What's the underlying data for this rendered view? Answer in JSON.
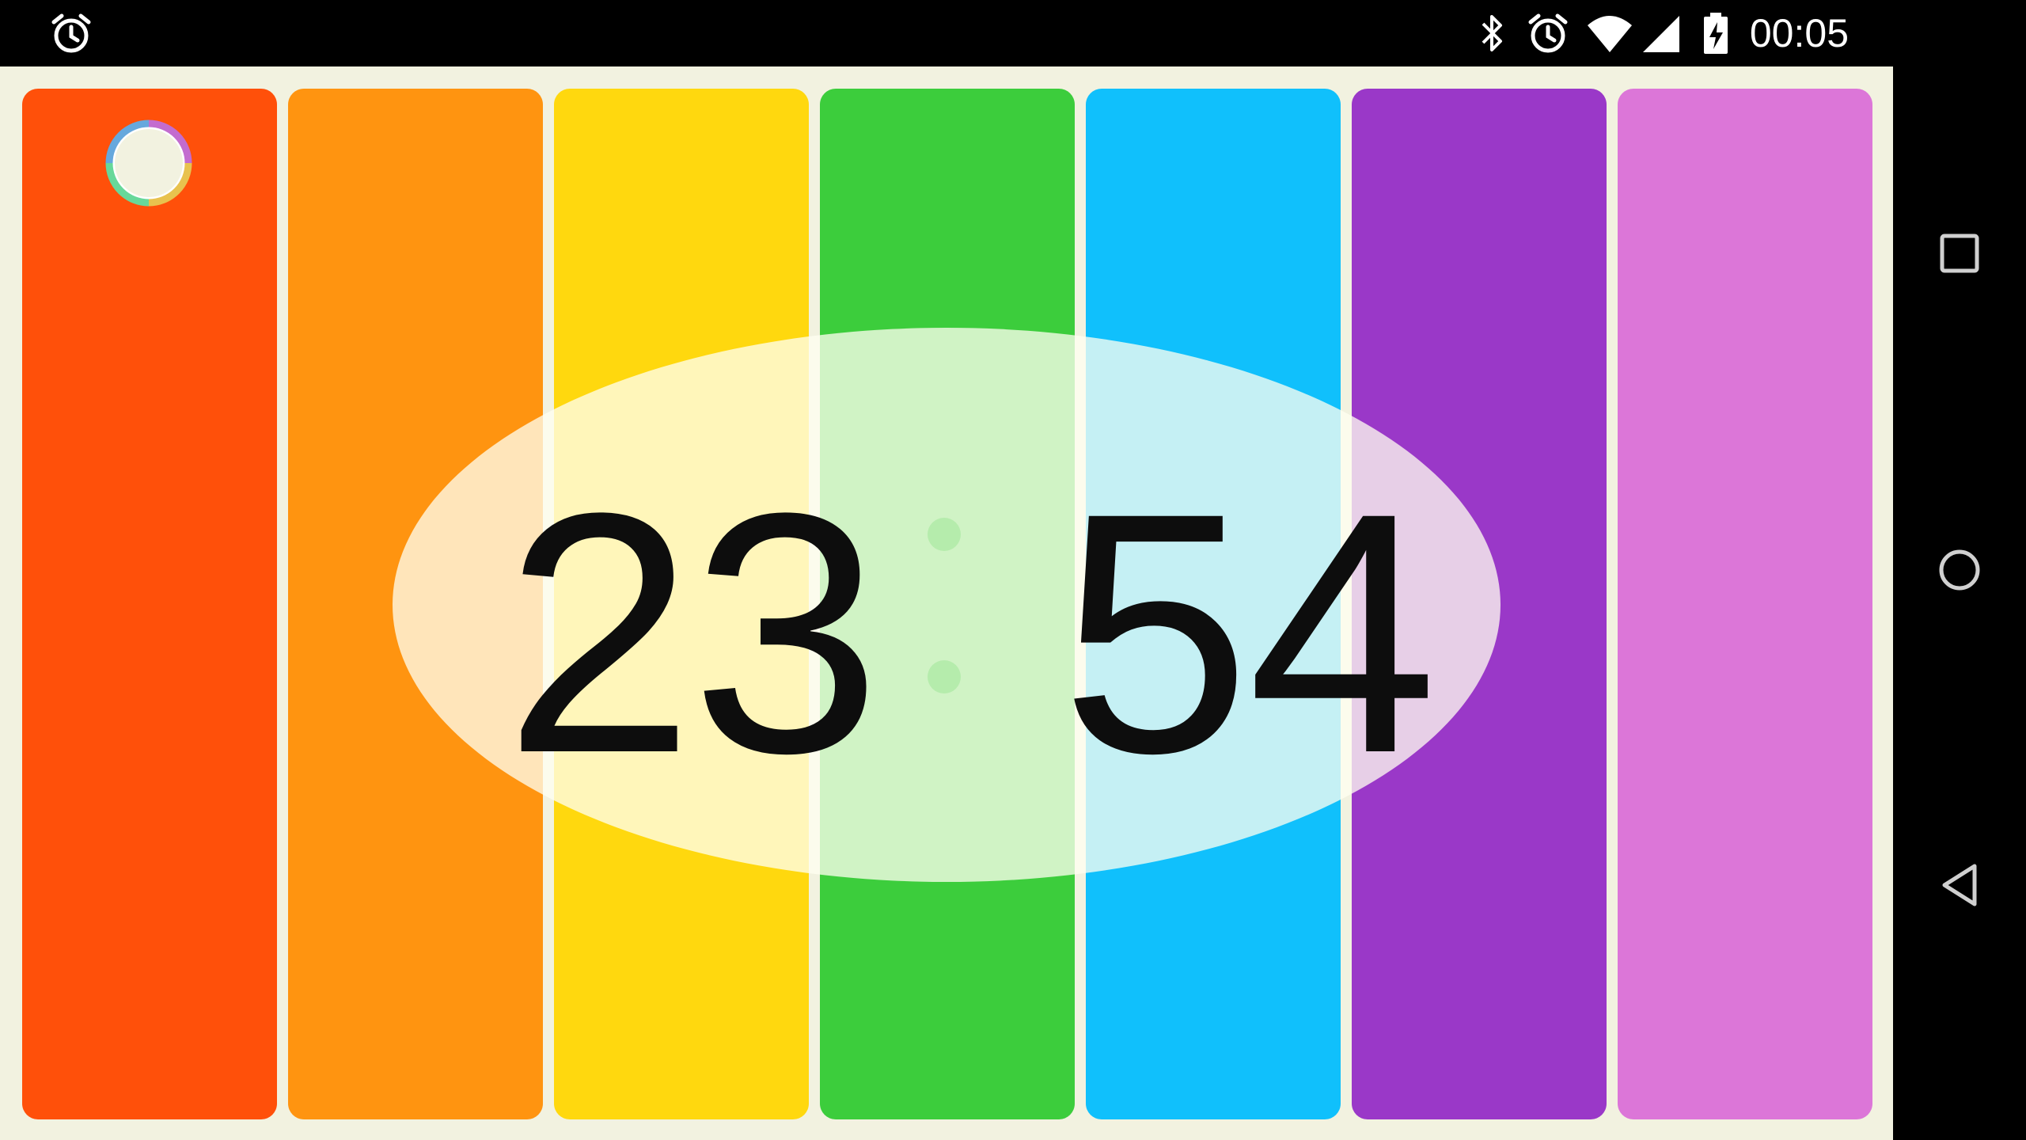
{
  "status_bar": {
    "time": "00:05",
    "left_icons": [
      "alarm-icon"
    ],
    "right_icons": [
      "bluetooth-icon",
      "alarm-icon",
      "wifi-icon",
      "cell-signal-icon",
      "battery-charging-icon"
    ]
  },
  "clock": {
    "hours": "23",
    "minutes": "54"
  },
  "bars": [
    {
      "name": "red",
      "color": "#ff500a"
    },
    {
      "name": "orange",
      "color": "#ff9410"
    },
    {
      "name": "yellow",
      "color": "#ffd80e"
    },
    {
      "name": "green",
      "color": "#3ccd3c"
    },
    {
      "name": "blue",
      "color": "#10c0fc"
    },
    {
      "name": "purple",
      "color": "#9a38c8"
    },
    {
      "name": "pink",
      "color": "#dc76d8"
    }
  ],
  "colors": {
    "background": "#f2f2e0",
    "ellipse": "#fffff0",
    "digits": "#0d0d0d"
  },
  "nav_bar": {
    "buttons": [
      "recents-icon",
      "home-icon",
      "back-icon"
    ]
  }
}
